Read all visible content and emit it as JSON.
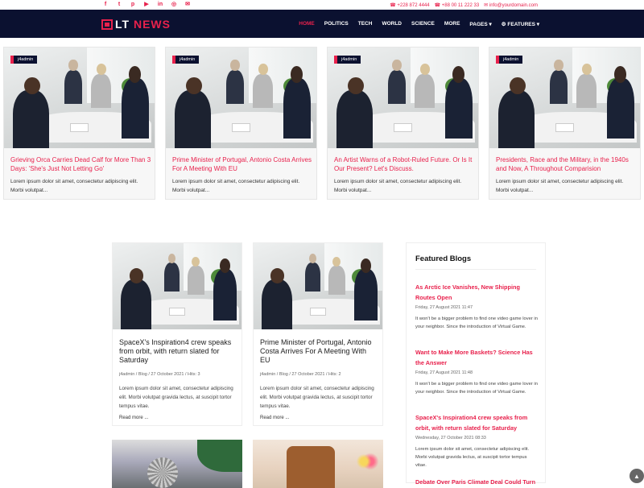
{
  "topbar": {
    "social_icons": [
      "facebook-icon",
      "twitter-icon",
      "pinterest-icon",
      "youtube-icon",
      "linkedin-icon",
      "instagram-icon",
      "email-icon"
    ],
    "phone_1": "+228 872 4444",
    "phone_2": "+88 00 11 222 33",
    "email": "info@yourdomain.com"
  },
  "brand": {
    "prefix": "LT",
    "suffix": "NEWS"
  },
  "menu": [
    "HOME",
    "POLITICS",
    "TECH",
    "WORLD",
    "SCIENCE",
    "MORE",
    "PAGES ▾",
    "⚙ FEATURES ▾"
  ],
  "featured_cards": [
    {
      "author": "j4admin",
      "title": "Grieving Orca Carries Dead Calf for More Than 3 Days: 'She's Just Not Letting Go'",
      "excerpt": "Lorem ipsum dolor sit amet, consectetur adipiscing elit. Morbi volutpat..."
    },
    {
      "author": "j4admin",
      "title": "Prime Minister of Portugal, Antonio Costa Arrives For A Meeting With EU",
      "excerpt": "Lorem ipsum dolor sit amet, consectetur adipiscing elit. Morbi volutpat..."
    },
    {
      "author": "j4admin",
      "title": "An Artist Warns of a Robot-Ruled Future. Or Is It Our Present? Let's Discuss.",
      "excerpt": "Lorem ipsum dolor sit amet, consectetur adipiscing elit. Morbi volutpat..."
    },
    {
      "author": "j4admin",
      "title": "Presidents, Race and the Military, in the 1940s and Now, A Throughout Comparision",
      "excerpt": "Lorem ipsum dolor sit amet, consectetur adipiscing elit. Morbi volutpat..."
    }
  ],
  "posts": [
    {
      "title": "SpaceX's Inspiration4 crew speaks from orbit, with return slated for Saturday",
      "meta": "j4admin   /   Blog   /   27 October 2021   /   Hits: 3",
      "excerpt": "Lorem ipsum dolor sit amet, consectetur adipiscing elit. Morbi volutpat gravida lectus, at suscipit tortor tempus vitae.",
      "read_more": "Read more ..."
    },
    {
      "title": "Prime Minister of Portugal, Antonio Costa Arrives For A Meeting With EU",
      "meta": "j4admin   /   Blog   /   27 October 2021   /   Hits: 2",
      "excerpt": "Lorem ipsum dolor sit amet, consectetur adipiscing elit. Morbi volutpat gravida lectus, at suscipit tortor tempus vitae.",
      "read_more": "Read more ..."
    }
  ],
  "sidebar": {
    "heading": "Featured Blogs",
    "items": [
      {
        "title": "As Arctic Ice Vanishes, New Shipping Routes Open",
        "date": "Friday, 27 August 2021 11:47",
        "excerpt": "It won't be a bigger problem to find one video game lover in your neighbor. Since the introduction of Virtual Game."
      },
      {
        "title": "Want to Make More Baskets? Science Has the Answer",
        "date": "Friday, 27 August 2021 11:48",
        "excerpt": "It won't be a bigger problem to find one video game lover in your neighbor. Since the introduction of Virtual Game."
      },
      {
        "title": "SpaceX's Inspiration4 crew speaks from orbit, with return slated for Saturday",
        "date": "Wednesday, 27 October 2021 08:33",
        "excerpt": "Lorem ipsum dolor sit amet, consectetur adipiscing elit. Morbi volutpat gravida lectus, at suscipit tortor tempus vitae."
      },
      {
        "title": "Debate Over Paris Climate Deal Could Turn",
        "date": "",
        "excerpt": ""
      }
    ]
  },
  "colors": {
    "accent": "#e8214c",
    "navy": "#0b1130"
  }
}
